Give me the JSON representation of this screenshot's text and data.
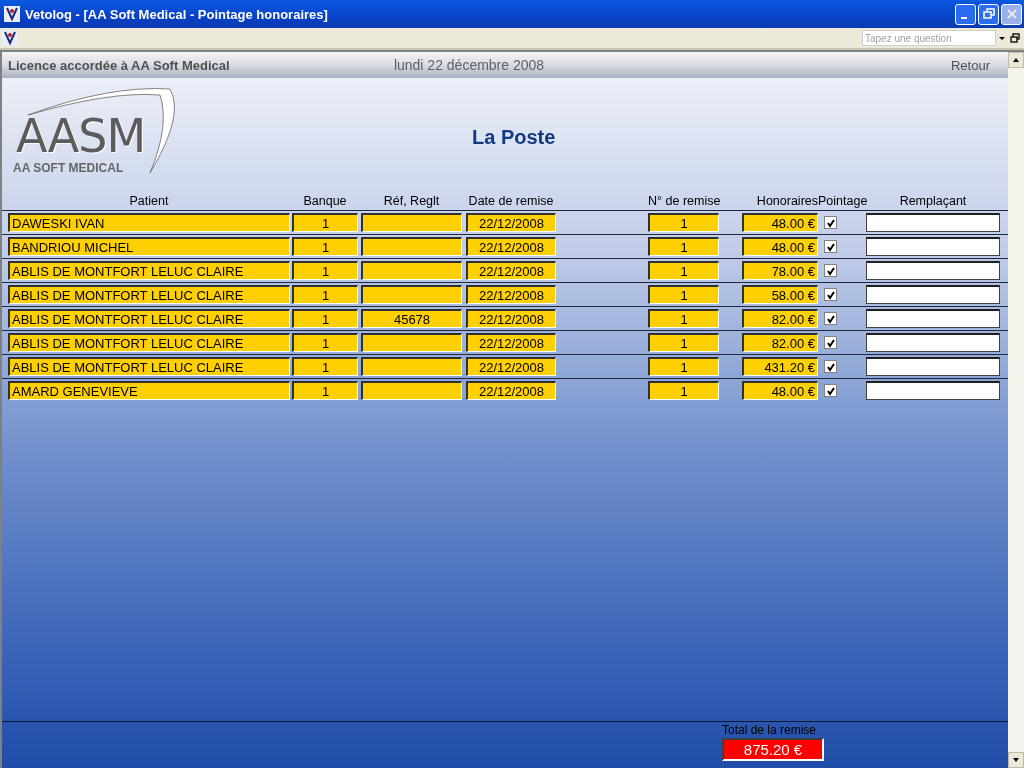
{
  "window": {
    "title": "Vetolog - [AA Soft Medical - Pointage honoraires]"
  },
  "menu_bar": {
    "question_placeholder": "Tapez une question"
  },
  "header": {
    "license": "Licence accordée à AA Soft Medical",
    "date": "lundi 22 décembre 2008",
    "back_link": "Retour"
  },
  "logo": {
    "mark": "AASM",
    "tagline": "AA SOFT MEDICAL"
  },
  "page_title": "La Poste",
  "table": {
    "columns": [
      "Patient",
      "Banque",
      "Réf, Reglt",
      "Date de remise",
      "N° de remise",
      "Honoraires",
      "Pointage",
      "Remplaçant"
    ],
    "rows": [
      {
        "patient": "DAWESKI IVAN",
        "banque": "1",
        "ref": "",
        "date": "22/12/2008",
        "remise": "1",
        "honoraires": "48.00 €",
        "checked": true
      },
      {
        "patient": "BANDRIOU MICHEL",
        "banque": "1",
        "ref": "",
        "date": "22/12/2008",
        "remise": "1",
        "honoraires": "48.00 €",
        "checked": true
      },
      {
        "patient": "ABLIS DE MONTFORT LELUC CLAIRE",
        "banque": "1",
        "ref": "",
        "date": "22/12/2008",
        "remise": "1",
        "honoraires": "78.00 €",
        "checked": true
      },
      {
        "patient": "ABLIS DE MONTFORT LELUC CLAIRE",
        "banque": "1",
        "ref": "",
        "date": "22/12/2008",
        "remise": "1",
        "honoraires": "58.00 €",
        "checked": true
      },
      {
        "patient": "ABLIS DE MONTFORT LELUC CLAIRE",
        "banque": "1",
        "ref": "45678",
        "date": "22/12/2008",
        "remise": "1",
        "honoraires": "82.00 €",
        "checked": true
      },
      {
        "patient": "ABLIS DE MONTFORT LELUC CLAIRE",
        "banque": "1",
        "ref": "",
        "date": "22/12/2008",
        "remise": "1",
        "honoraires": "82.00 €",
        "checked": true
      },
      {
        "patient": "ABLIS DE MONTFORT LELUC CLAIRE",
        "banque": "1",
        "ref": "",
        "date": "22/12/2008",
        "remise": "1",
        "honoraires": "431.20 €",
        "checked": true
      },
      {
        "patient": "AMARD GENEVIEVE",
        "banque": "1",
        "ref": "",
        "date": "22/12/2008",
        "remise": "1",
        "honoraires": "48.00 €",
        "checked": true
      }
    ]
  },
  "total": {
    "label": "Total de la remise",
    "value": "875.20 €"
  }
}
